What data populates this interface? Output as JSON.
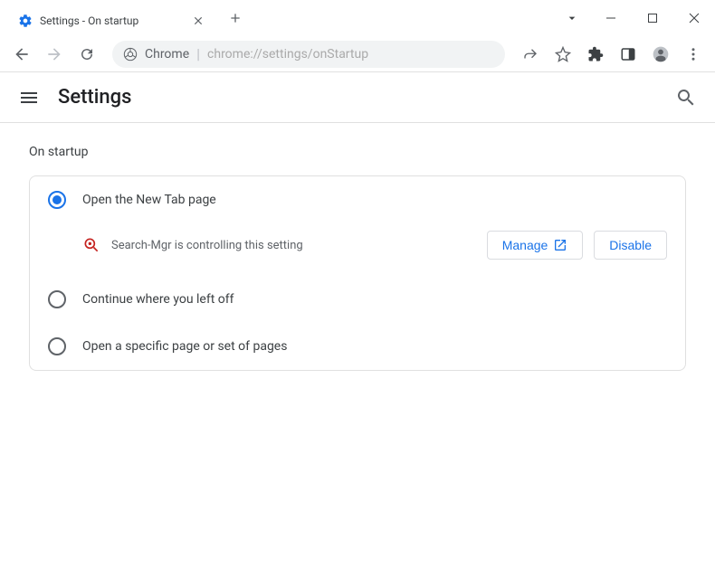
{
  "window": {
    "tab_title": "Settings - On startup"
  },
  "address": {
    "prefix": "Chrome",
    "url": "chrome://settings/onStartup"
  },
  "settings": {
    "title": "Settings",
    "section": "On startup",
    "options": {
      "new_tab": "Open the New Tab page",
      "continue": "Continue where you left off",
      "specific": "Open a specific page or set of pages"
    },
    "controlled": {
      "text": "Search-Mgr is controlling this setting",
      "manage": "Manage",
      "disable": "Disable"
    }
  }
}
